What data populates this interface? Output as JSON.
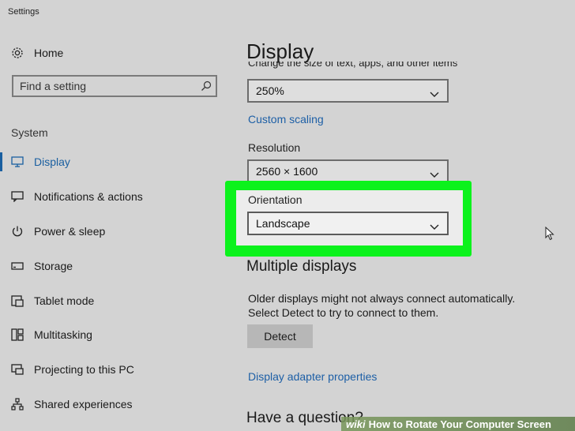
{
  "window": {
    "title": "Settings"
  },
  "sidebar": {
    "home_label": "Home",
    "search_placeholder": "Find a setting",
    "section_label": "System",
    "items": [
      {
        "label": "Display",
        "icon": "monitor-icon",
        "active": true
      },
      {
        "label": "Notifications & actions",
        "icon": "notification-icon",
        "active": false
      },
      {
        "label": "Power & sleep",
        "icon": "power-icon",
        "active": false
      },
      {
        "label": "Storage",
        "icon": "storage-icon",
        "active": false
      },
      {
        "label": "Tablet mode",
        "icon": "tablet-icon",
        "active": false
      },
      {
        "label": "Multitasking",
        "icon": "multitasking-icon",
        "active": false
      },
      {
        "label": "Projecting to this PC",
        "icon": "projector-icon",
        "active": false
      },
      {
        "label": "Shared experiences",
        "icon": "share-icon",
        "active": false
      }
    ]
  },
  "main": {
    "page_title": "Display",
    "scale_description_partial": "Change the size of text, apps, and other items",
    "scale_value": "250%",
    "custom_scaling_link": "Custom scaling",
    "resolution_label": "Resolution",
    "resolution_value": "2560 × 1600",
    "orientation_label": "Orientation",
    "orientation_value": "Landscape",
    "multiple_displays_heading": "Multiple displays",
    "multiple_displays_text": "Older displays might not always connect automatically. Select Detect to try to connect to them.",
    "detect_button": "Detect",
    "adapter_link": "Display adapter properties",
    "question_heading": "Have a question?"
  },
  "highlight_color": "#0cf21c",
  "accent_color": "#1a5fa0",
  "banner": {
    "brand": "wiki",
    "text": "How to Rotate Your Computer Screen"
  }
}
